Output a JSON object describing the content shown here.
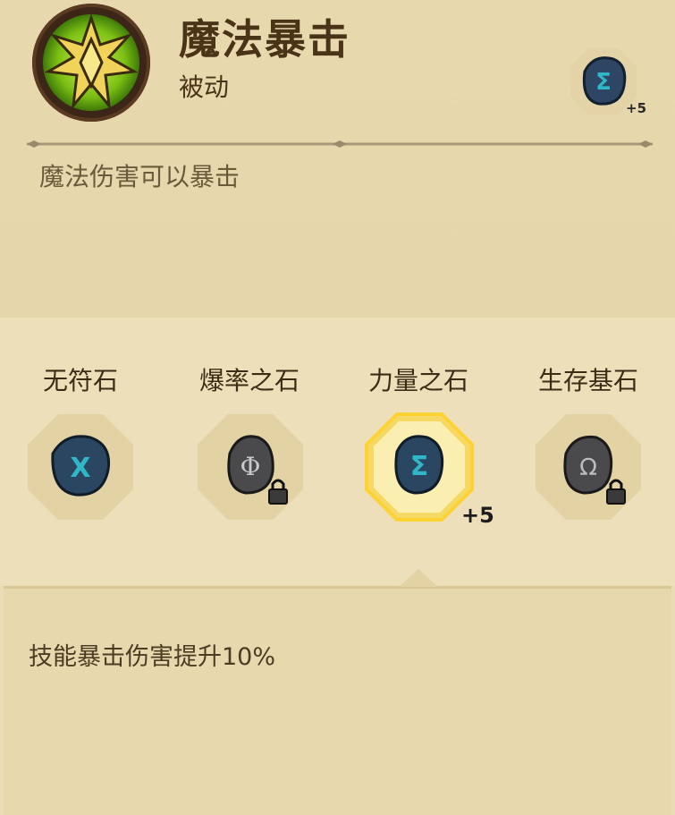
{
  "skill": {
    "name": "魔法暴击",
    "type": "被动",
    "description": "魔法伤害可以暴击",
    "equipped_rune_level": "+5"
  },
  "runes": [
    {
      "label": "无符石",
      "icon": "rune-x-icon",
      "locked": false,
      "selected": false
    },
    {
      "label": "爆率之石",
      "icon": "rune-phi-icon",
      "locked": true,
      "selected": false
    },
    {
      "label": "力量之石",
      "icon": "rune-sigma-icon",
      "locked": false,
      "selected": true,
      "level": "+5"
    },
    {
      "label": "生存基石",
      "icon": "rune-omega-icon",
      "locked": true,
      "selected": false
    }
  ],
  "bonus": {
    "text": "技能暴击伤害提升10%"
  },
  "colors": {
    "parchment": "#eadcb4",
    "rune_teal": "#2fb7c7",
    "rune_blue": "#2e4563",
    "rune_gray": "#4a4a4c",
    "highlight": "#ffd74a",
    "skill_icon_green": "#8fd11a"
  }
}
